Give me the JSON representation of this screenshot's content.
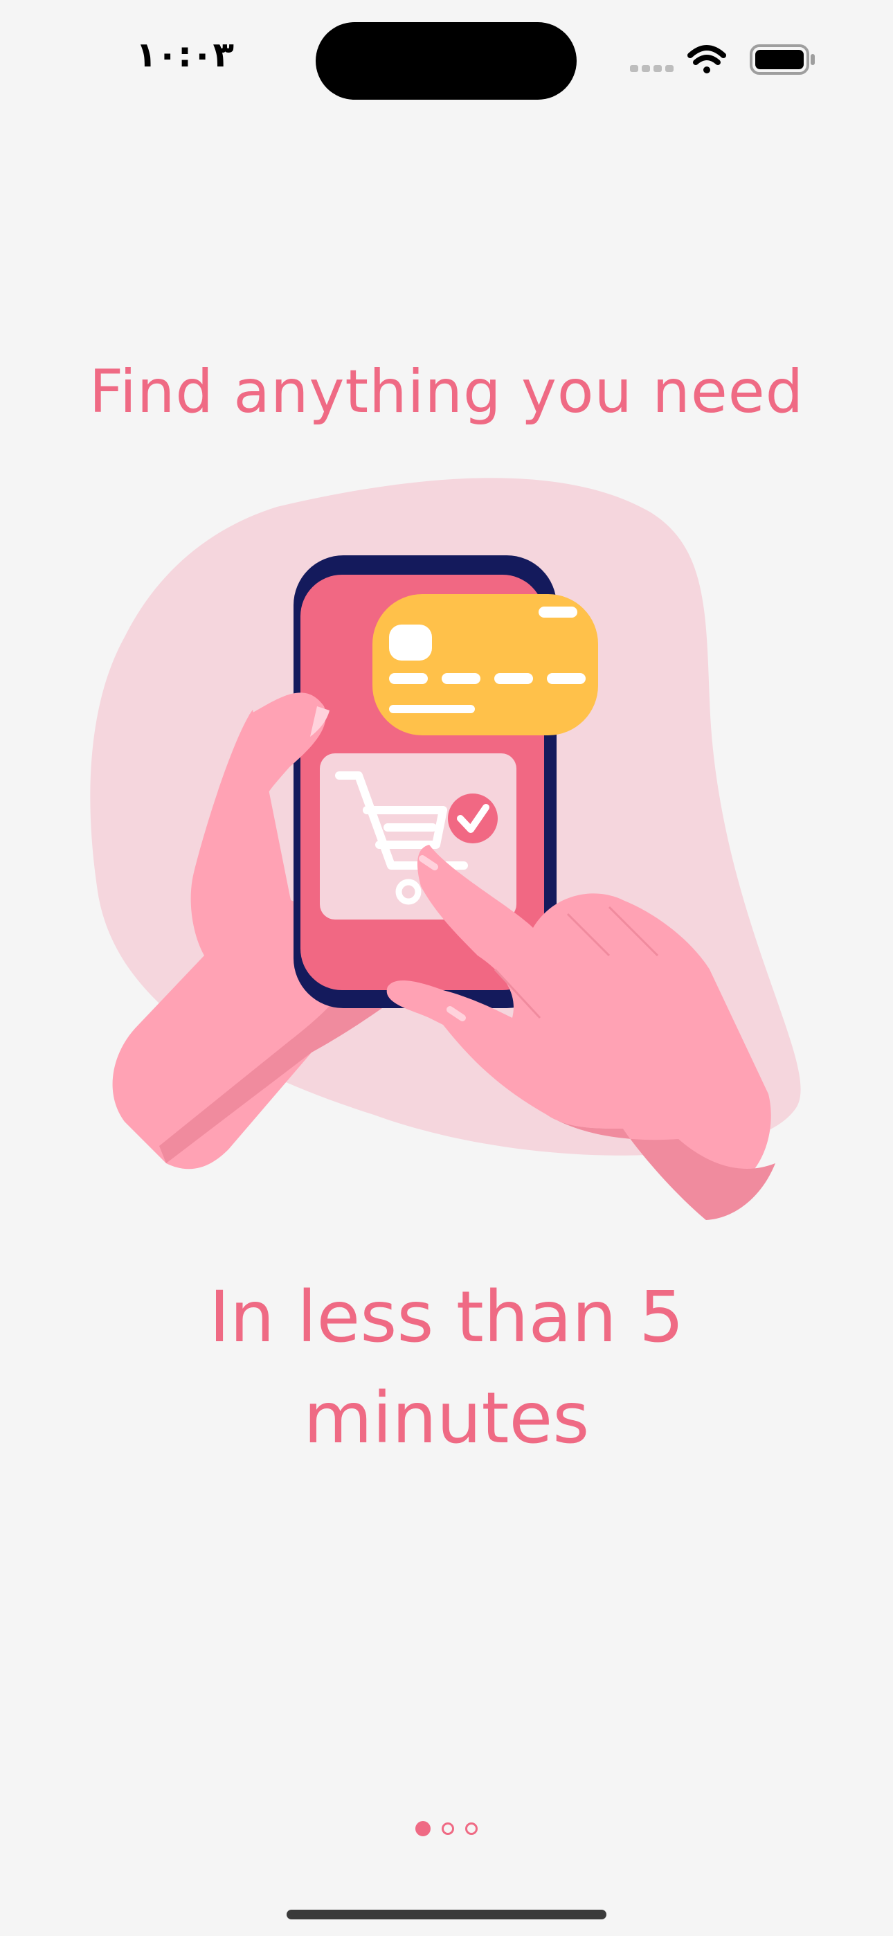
{
  "status_bar": {
    "time": "١٠:٠٣",
    "icons": [
      "cellular-signal-icon",
      "wifi-icon",
      "battery-icon"
    ]
  },
  "onboarding": {
    "title": "Find anything you need",
    "subtitle": "In less than 5 minutes",
    "illustration": "hands-holding-phone-shopping-illustration"
  },
  "page_indicator": {
    "total": 3,
    "current": 1
  },
  "colors": {
    "accent": "#ef6a84",
    "background": "#f5f5f5",
    "blob": "#f5d6dd",
    "phone_frame": "#141a5c",
    "card": "#ffc14a",
    "skin": "#ffa2b4",
    "skin_shadow": "#f08b9e"
  }
}
